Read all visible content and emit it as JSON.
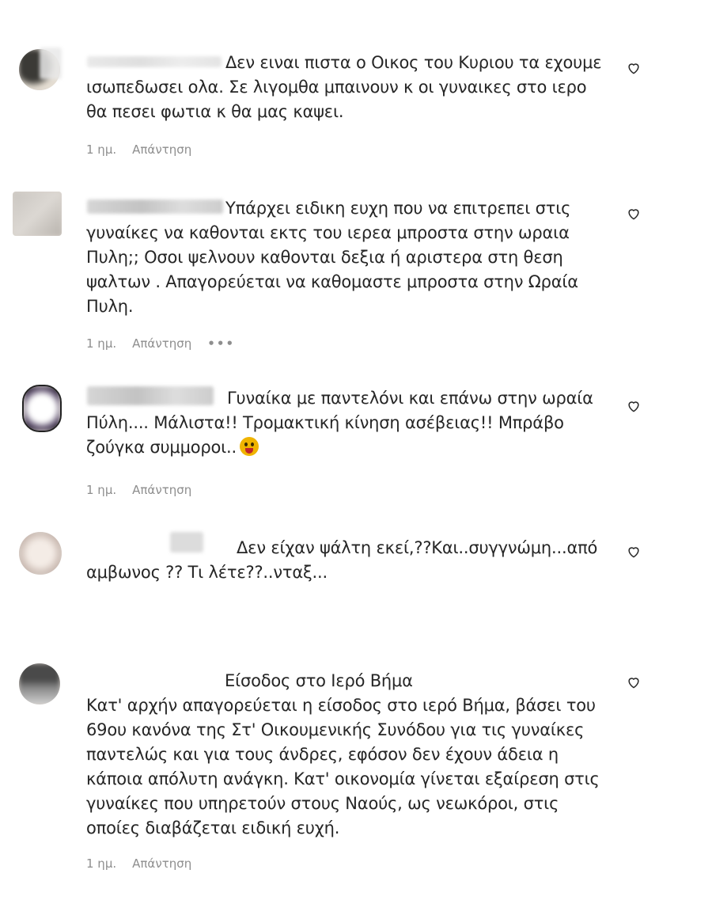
{
  "comments": [
    {
      "text": "Δεν ειναι πιστα ο Οικος του Κυριου τα εχουμε ισωπεδωσει ολα. Σε λιγομθα μπαινουν κ οι γυναικες στο ιερο θα πεσει φωτια κ θα μας καψει.",
      "time": "1 ημ.",
      "reply": "Απάντηση"
    },
    {
      "text": "Υπάρχει ειδικη ευχη που να επιτρεπει στις γυναίκες να καθονται εκτς του ιερεα μπροστα στην ωραια Πυλη;; Οσοι ψελνουν καθονται δεξια ή αριστερα στη θεση ψαλτων . Απαγορεύεται να καθομαστε μπροστα στην Ωραία Πυλη.",
      "time": "1 ημ.",
      "reply": "Απάντηση",
      "more": "•••"
    },
    {
      "text": "Γυναίκα με παντελόνι και επάνω στην ωραία Πύλη.... Μάλιστα!! Τρομακτική κίνηση ασέβειας!! Μπράβο ζούγκα συμμοροι..",
      "emoji": "tongue-out-emoji",
      "time": "1 ημ.",
      "reply": "Απάντηση"
    },
    {
      "text": "Δεν είχαν ψάλτη εκεί,??Και..συγγνώμη...από αμβωνος ?? Τι λέτε??..νταξ..."
    },
    {
      "title": "Είσοδος στο Ιερό Βήμα",
      "text": "Κατ' αρχήν απαγορεύεται η είσοδος στο ιερό Βήμα, βάσει του 69ου κανόνα της Στ' Οικουμενικής Συνόδου για τις γυναίκες παντελώς και για τους άνδρες, εφόσον δεν έχουν άδεια η κάποια απόλυτη ανάγκη. Κατ' οικονομία γίνεται εξαίρεση στις γυναίκες που υπηρετούν στους Ναούς, ως νεωκόροι, στις οποίες διαβάζεται ειδική ευχή.",
      "time": "1 ημ.",
      "reply": "Απάντηση"
    }
  ],
  "icons": {
    "like": "heart-outline-icon"
  },
  "colors": {
    "text": "#262626",
    "meta": "#8e8e8e"
  }
}
